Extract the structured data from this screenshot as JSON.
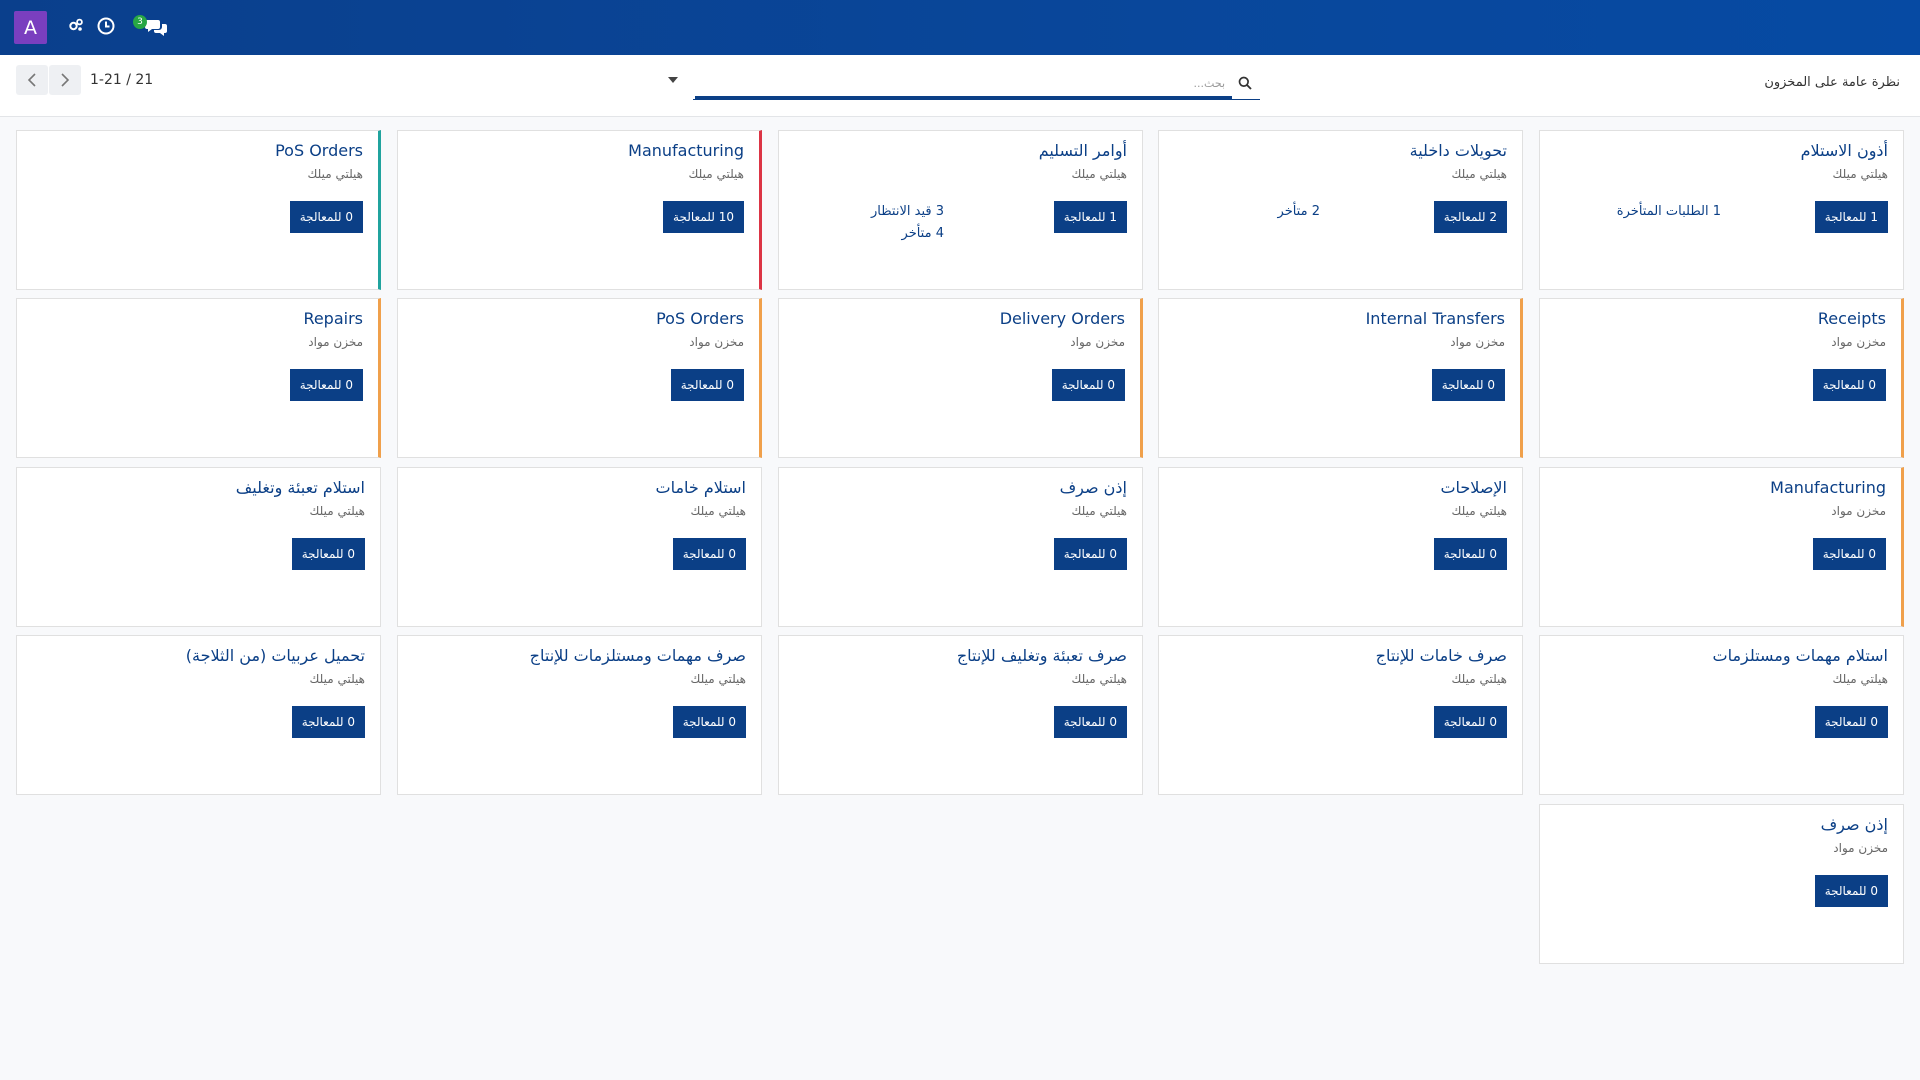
{
  "nav": {
    "avatar_letter": "A",
    "messages_badge": "3"
  },
  "control": {
    "pager": "1-21 / 21",
    "search_placeholder": "بحث...",
    "breadcrumb": "نظرة عامة على المخزون"
  },
  "colors": {
    "brand": "#0b3f86",
    "teal": "#20a39e",
    "red": "#dc3545",
    "orange": "#f0a04b"
  },
  "cards": [
    {
      "title": "أذون الاستلام",
      "sub": "هيلتي ميلك",
      "btn": "1 للمعالجة",
      "stats": [
        "1 الطلبات المتأخرة"
      ]
    },
    {
      "title": "تحويلات داخلية",
      "sub": "هيلتي ميلك",
      "btn": "2 للمعالجة",
      "stats": [
        "2 متأخر"
      ]
    },
    {
      "title": "أوامر التسليم",
      "sub": "هيلتي ميلك",
      "btn": "1 للمعالجة",
      "stats": [
        "3 قيد الانتظار",
        "4 متأخر"
      ]
    },
    {
      "title": "Manufacturing",
      "sub": "هيلتي ميلك",
      "btn": "10 للمعالجة",
      "stats": []
    },
    {
      "title": "PoS Orders",
      "sub": "هيلتي ميلك",
      "btn": "0 للمعالجة",
      "stats": []
    },
    {
      "title": "Receipts",
      "sub": "مخزن مواد",
      "btn": "0 للمعالجة",
      "stats": []
    },
    {
      "title": "Internal Transfers",
      "sub": "مخزن مواد",
      "btn": "0 للمعالجة",
      "stats": []
    },
    {
      "title": "Delivery Orders",
      "sub": "مخزن مواد",
      "btn": "0 للمعالجة",
      "stats": []
    },
    {
      "title": "PoS Orders",
      "sub": "مخزن مواد",
      "btn": "0 للمعالجة",
      "stats": []
    },
    {
      "title": "Repairs",
      "sub": "مخزن مواد",
      "btn": "0 للمعالجة",
      "stats": []
    },
    {
      "title": "Manufacturing",
      "sub": "مخزن مواد",
      "btn": "0 للمعالجة",
      "stats": []
    },
    {
      "title": "الإصلاحات",
      "sub": "هيلتي ميلك",
      "btn": "0 للمعالجة",
      "stats": []
    },
    {
      "title": "إذن صرف",
      "sub": "هيلتي ميلك",
      "btn": "0 للمعالجة",
      "stats": []
    },
    {
      "title": "استلام خامات",
      "sub": "هيلتي ميلك",
      "btn": "0 للمعالجة",
      "stats": []
    },
    {
      "title": "استلام تعبئة وتغليف",
      "sub": "هيلتي ميلك",
      "btn": "0 للمعالجة",
      "stats": []
    },
    {
      "title": "استلام مهمات ومستلزمات",
      "sub": "هيلتي ميلك",
      "btn": "0 للمعالجة",
      "stats": []
    },
    {
      "title": "صرف خامات للإنتاج",
      "sub": "هيلتي ميلك",
      "btn": "0 للمعالجة",
      "stats": []
    },
    {
      "title": "صرف تعبئة وتغليف للإنتاج",
      "sub": "هيلتي ميلك",
      "btn": "0 للمعالجة",
      "stats": []
    },
    {
      "title": "صرف مهمات ومستلزمات للإنتاج",
      "sub": "هيلتي ميلك",
      "btn": "0 للمعالجة",
      "stats": []
    },
    {
      "title": "تحميل عربيات (من الثلاجة)",
      "sub": "هيلتي ميلك",
      "btn": "0 للمعالجة",
      "stats": []
    },
    {
      "title": "إذن صرف",
      "sub": "مخزن مواد",
      "btn": "0 للمعالجة",
      "stats": []
    }
  ]
}
